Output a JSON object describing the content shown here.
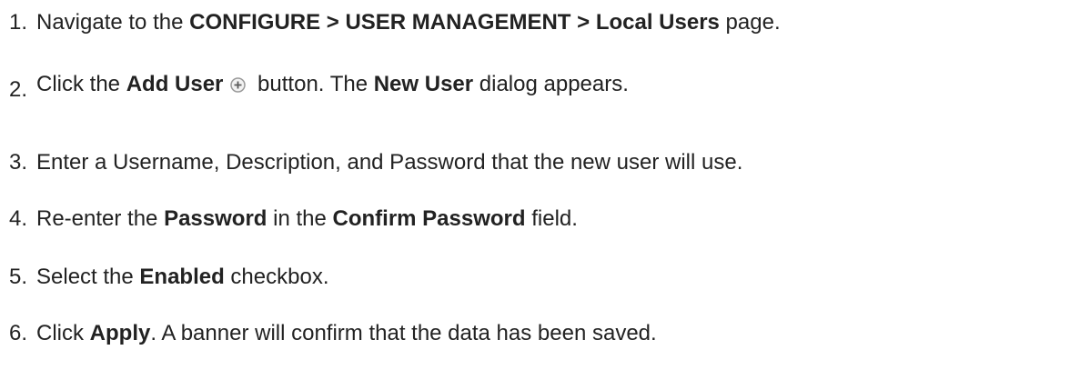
{
  "steps": [
    {
      "number": "1.",
      "pre": "Navigate to the ",
      "bold": "CONFIGURE > USER MANAGEMENT > Local Users",
      "post": " page."
    },
    {
      "number": "2.",
      "pre": "Click the ",
      "bold": "Add User",
      "icon": "add-circle-icon",
      "mid": " button. The ",
      "bold2": "New User",
      "post": " dialog appears."
    },
    {
      "number": "3.",
      "text": "Enter a Username, Description, and Password that the new user will use."
    },
    {
      "number": "4.",
      "pre": "Re-enter the ",
      "bold": "Password",
      "mid": " in the ",
      "bold2": "Confirm Password",
      "post": " field."
    },
    {
      "number": "5.",
      "pre": "Select the ",
      "bold": "Enabled",
      "post": " checkbox."
    },
    {
      "number": "6.",
      "pre": "Click ",
      "bold": "Apply",
      "post": ". A banner will confirm that the data has been saved."
    }
  ],
  "colors": {
    "text": "#222222",
    "icon_ring": "#9a9a9a",
    "icon_fill": "#f2f2f2",
    "icon_plus": "#5a5a5a"
  }
}
